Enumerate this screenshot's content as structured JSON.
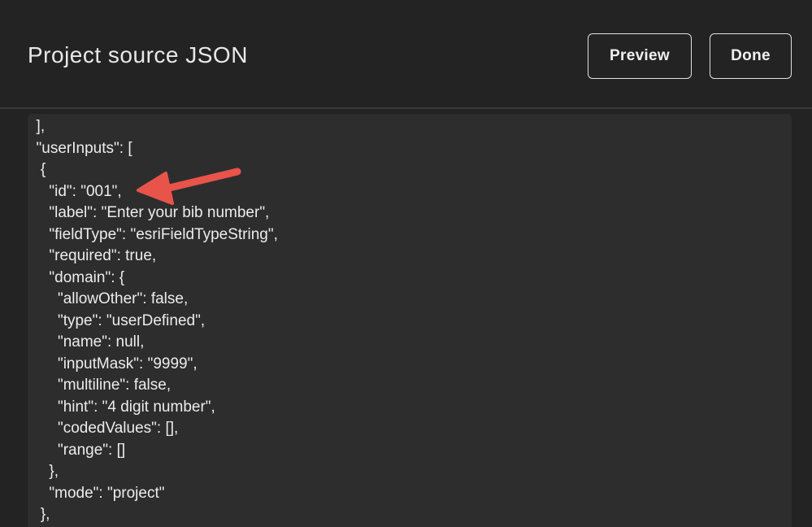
{
  "header": {
    "title": "Project source JSON",
    "preview_label": "Preview",
    "done_label": "Done"
  },
  "editor": {
    "lines": [
      "  ],",
      "  \"userInputs\": [",
      "   {",
      "     \"id\": \"001\",",
      "     \"label\": \"Enter your bib number\",",
      "     \"fieldType\": \"esriFieldTypeString\",",
      "     \"required\": true,",
      "     \"domain\": {",
      "       \"allowOther\": false,",
      "       \"type\": \"userDefined\",",
      "       \"name\": null,",
      "       \"inputMask\": \"9999\",",
      "       \"multiline\": false,",
      "       \"hint\": \"4 digit number\",",
      "       \"codedValues\": [],",
      "       \"range\": []",
      "     },",
      "     \"mode\": \"project\"",
      "   },"
    ]
  },
  "colors": {
    "background": "#232323",
    "editor_background": "#2d2d2d",
    "text": "#ececec",
    "annotation_arrow": "#e8534a"
  }
}
